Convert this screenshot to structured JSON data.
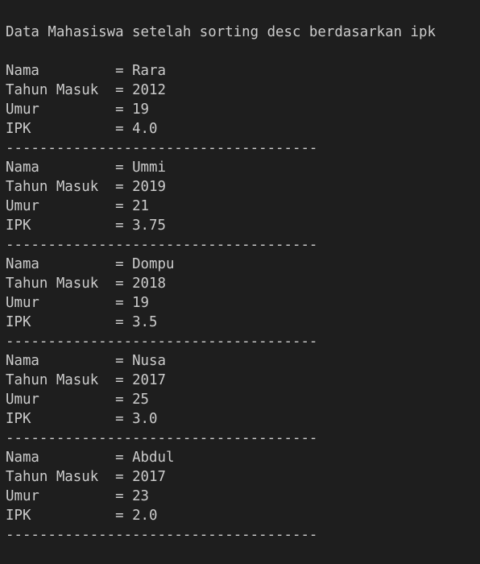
{
  "terminal": {
    "header": "Data Mahasiswa setelah sorting desc berdasarkan ipk",
    "separator": "-------------------------------------",
    "labels": {
      "nama": "Nama         ",
      "tahun_masuk": "Tahun Masuk  ",
      "umur": "Umur         ",
      "ipk": "IPK          "
    },
    "equals": "= ",
    "records": [
      {
        "nama": "Rara",
        "tahun_masuk": "2012",
        "umur": "19",
        "ipk": "4.0"
      },
      {
        "nama": "Ummi",
        "tahun_masuk": "2019",
        "umur": "21",
        "ipk": "3.75"
      },
      {
        "nama": "Dompu",
        "tahun_masuk": "2018",
        "umur": "19",
        "ipk": "3.5"
      },
      {
        "nama": "Nusa",
        "tahun_masuk": "2017",
        "umur": "25",
        "ipk": "3.0"
      },
      {
        "nama": "Abdul",
        "tahun_masuk": "2017",
        "umur": "23",
        "ipk": "2.0"
      }
    ]
  }
}
